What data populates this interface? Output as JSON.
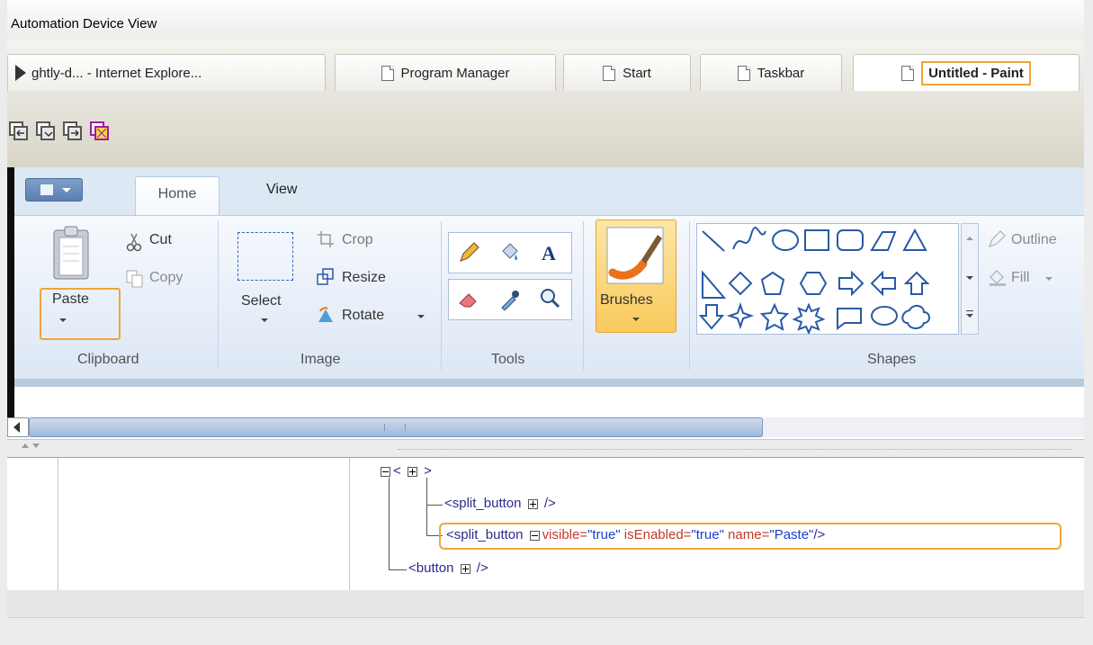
{
  "window": {
    "title": "Automation Device View"
  },
  "tabs": [
    {
      "label": "ghtly-d... - Internet Explore...",
      "active": false
    },
    {
      "label": "Program Manager",
      "active": false
    },
    {
      "label": "Start",
      "active": false
    },
    {
      "label": "Taskbar",
      "active": false
    },
    {
      "label": "Untitled - Paint",
      "active": true
    }
  ],
  "toolbar": {
    "icons": [
      "back-window-icon",
      "window-icon",
      "forward-window-icon",
      "highlight-window-icon"
    ]
  },
  "paint": {
    "ribbon_tabs": {
      "home": "Home",
      "view": "View"
    },
    "clipboard": {
      "paste": "Paste",
      "cut": "Cut",
      "copy": "Copy",
      "group": "Clipboard"
    },
    "image": {
      "select": "Select",
      "crop": "Crop",
      "resize": "Resize",
      "rotate": "Rotate",
      "group": "Image"
    },
    "tools": {
      "group": "Tools"
    },
    "brushes": {
      "label": "Brushes"
    },
    "shapes": {
      "outline": "Outline",
      "fill": "Fill",
      "group": "Shapes"
    }
  },
  "tree": {
    "root": "< ",
    "root_close": " >",
    "child1_tag": "<split_button ",
    "child1_close": " />",
    "child2_tag": "<split_button ",
    "child2_attr1": "visible=",
    "child2_val1": "\"true\"",
    "child2_attr2": " isEnabled=",
    "child2_val2": "\"true\"",
    "child2_attr3": " name=",
    "child2_val3": "\"Paste\"",
    "child2_close": "/>",
    "child3_tag": "<button ",
    "child3_close": " />"
  }
}
